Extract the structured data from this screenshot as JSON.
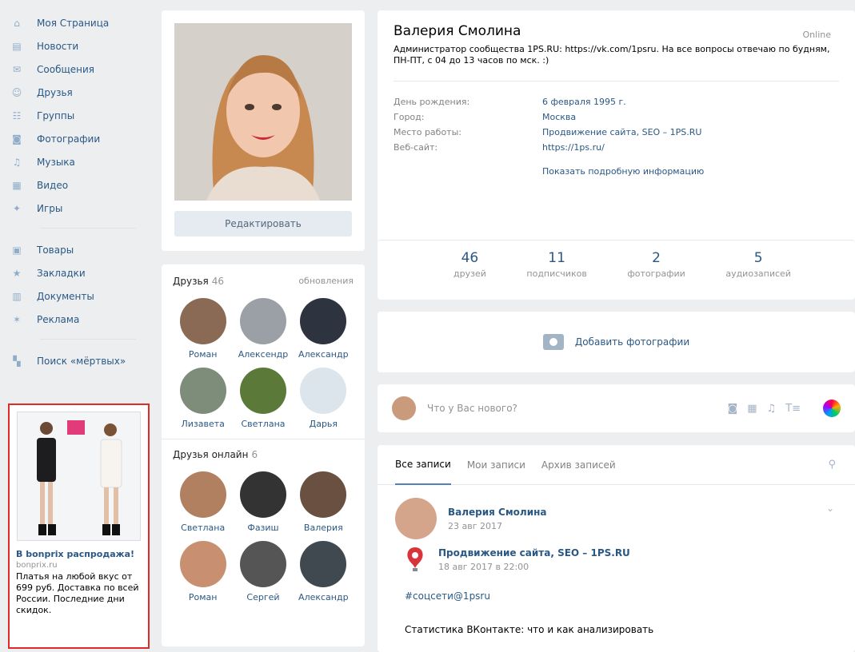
{
  "nav": {
    "items": [
      {
        "label": "Моя Страница",
        "icon": "home-icon"
      },
      {
        "label": "Новости",
        "icon": "news-icon"
      },
      {
        "label": "Сообщения",
        "icon": "messages-icon"
      },
      {
        "label": "Друзья",
        "icon": "friends-icon"
      },
      {
        "label": "Группы",
        "icon": "groups-icon"
      },
      {
        "label": "Фотографии",
        "icon": "photos-icon"
      },
      {
        "label": "Музыка",
        "icon": "music-icon"
      },
      {
        "label": "Видео",
        "icon": "video-icon"
      },
      {
        "label": "Игры",
        "icon": "games-icon"
      }
    ],
    "items2": [
      {
        "label": "Товары",
        "icon": "goods-icon"
      },
      {
        "label": "Закладки",
        "icon": "bookmarks-icon"
      },
      {
        "label": "Документы",
        "icon": "documents-icon"
      },
      {
        "label": "Реклама",
        "icon": "ads-icon"
      }
    ],
    "items3": [
      {
        "label": "Поиск «мёртвых»",
        "icon": "app-icon"
      }
    ]
  },
  "ad": {
    "title": "В bonprix распродажа!",
    "domain": "bonprix.ru",
    "text": "Платья на любой вкус от 699 руб. Доставка по всей России. Последние дни скидок."
  },
  "photo": {
    "edit_label": "Редактировать"
  },
  "friends": {
    "title": "Друзья",
    "count": "46",
    "link": "обновления",
    "list": [
      {
        "name": "Роман"
      },
      {
        "name": "Алексендр"
      },
      {
        "name": "Александр"
      },
      {
        "name": "Лизавета"
      },
      {
        "name": "Светлана"
      },
      {
        "name": "Дарья"
      }
    ]
  },
  "friends_online": {
    "title": "Друзья онлайн",
    "count": "6",
    "list": [
      {
        "name": "Светлана"
      },
      {
        "name": "Фазиш"
      },
      {
        "name": "Валерия"
      },
      {
        "name": "Роман"
      },
      {
        "name": "Сергей"
      },
      {
        "name": "Александр"
      }
    ]
  },
  "profile": {
    "name": "Валерия Смолина",
    "online": "Online",
    "status": "Администратор сообщества 1PS.RU: https://vk.com/1psru. На все вопросы отвечаю по будням, ПН-ПТ, с 04 до 13 часов по мск. :)",
    "info": [
      {
        "k": "День рождения:",
        "v": "6 февраля 1995 г."
      },
      {
        "k": "Город:",
        "v": "Москва"
      },
      {
        "k": "Место работы:",
        "v": "Продвижение сайта, SEO – 1PS.RU"
      },
      {
        "k": "Веб-сайт:",
        "v": "https://1ps.ru/"
      }
    ],
    "more": "Показать подробную информацию"
  },
  "counters": [
    {
      "num": "46",
      "lbl": "друзей"
    },
    {
      "num": "11",
      "lbl": "подписчиков"
    },
    {
      "num": "2",
      "lbl": "фотографии"
    },
    {
      "num": "5",
      "lbl": "аудиозаписей"
    }
  ],
  "add_photo": {
    "label": "Добавить фотографии"
  },
  "post_input": {
    "placeholder": "Что у Вас нового?"
  },
  "wall": {
    "tabs": [
      "Все записи",
      "Мои записи",
      "Архив записей"
    ],
    "post": {
      "author": "Валерия Смолина",
      "date": "23 авг 2017",
      "repost_author": "Продвижение сайта, SEO – 1PS.RU",
      "repost_date": "18 авг 2017 в 22:00",
      "hashtag": "#соцсети@1psru",
      "text": "Статистика ВКонтакте: что и как анализировать"
    }
  },
  "colors": {
    "link": "#2a5885",
    "bg": "#edeef0",
    "ad_border": "#e02a2a"
  }
}
